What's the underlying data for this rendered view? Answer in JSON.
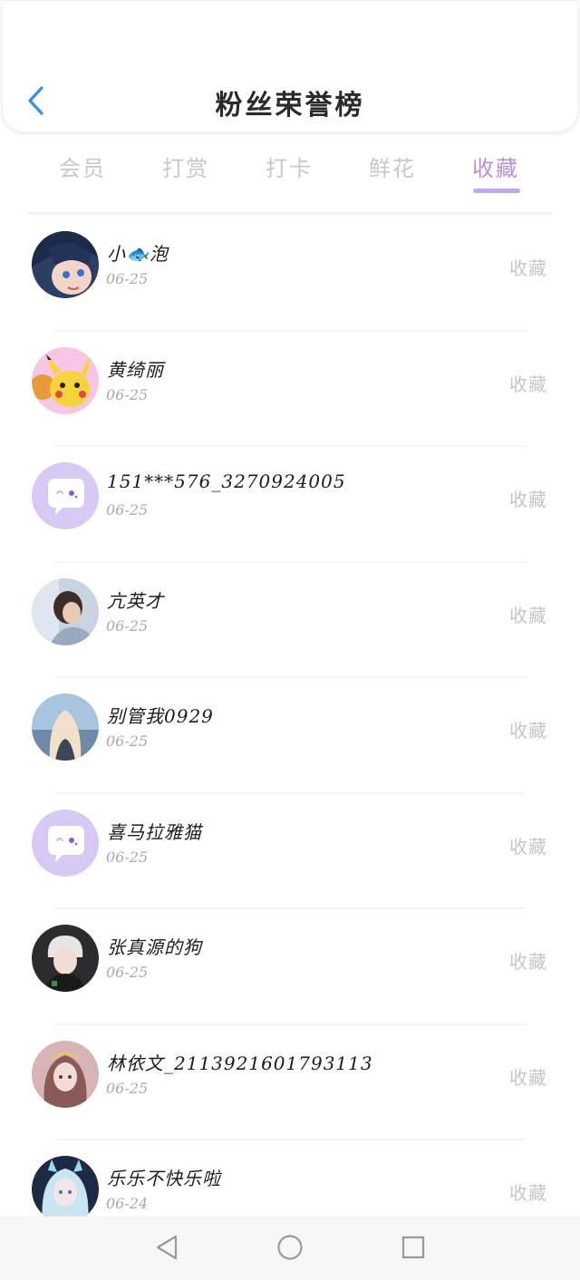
{
  "header": {
    "title": "粉丝荣誉榜",
    "back_icon": "chevron-left-icon"
  },
  "tabs": [
    {
      "label": "会员",
      "active": false
    },
    {
      "label": "打赏",
      "active": false
    },
    {
      "label": "打卡",
      "active": false
    },
    {
      "label": "鲜花",
      "active": false
    },
    {
      "label": "收藏",
      "active": true
    }
  ],
  "colors": {
    "accent": "#b591dd",
    "back_icon": "#3a8ee6",
    "muted_text": "#c6c6c6",
    "default_avatar_bg": "#d8c8f4"
  },
  "fans": [
    {
      "name": "小🐟泡",
      "date": "06-25",
      "action": "收藏",
      "avatar": "anime-boy-avatar"
    },
    {
      "name": "黄绮丽",
      "date": "06-25",
      "action": "收藏",
      "avatar": "pikachu-avatar"
    },
    {
      "name": "151***576_3270924005",
      "date": "06-25",
      "action": "收藏",
      "avatar": "default-chat-avatar"
    },
    {
      "name": "亢英才",
      "date": "06-25",
      "action": "收藏",
      "avatar": "girl-short-hair-avatar"
    },
    {
      "name": "别管我0929",
      "date": "06-25",
      "action": "收藏",
      "avatar": "blonde-girl-avatar"
    },
    {
      "name": "喜马拉雅猫",
      "date": "06-25",
      "action": "收藏",
      "avatar": "default-chat-avatar"
    },
    {
      "name": "张真源的狗",
      "date": "06-25",
      "action": "收藏",
      "avatar": "white-hair-boy-avatar"
    },
    {
      "name": "林依文_2113921601793113",
      "date": "06-25",
      "action": "收藏",
      "avatar": "pink-hair-girl-avatar"
    },
    {
      "name": "乐乐不快乐啦",
      "date": "06-24",
      "action": "收藏",
      "avatar": "silver-hair-girl-avatar"
    }
  ],
  "navbar": {
    "back_icon": "triangle-back-icon",
    "home_icon": "circle-home-icon",
    "recents_icon": "square-recents-icon"
  }
}
